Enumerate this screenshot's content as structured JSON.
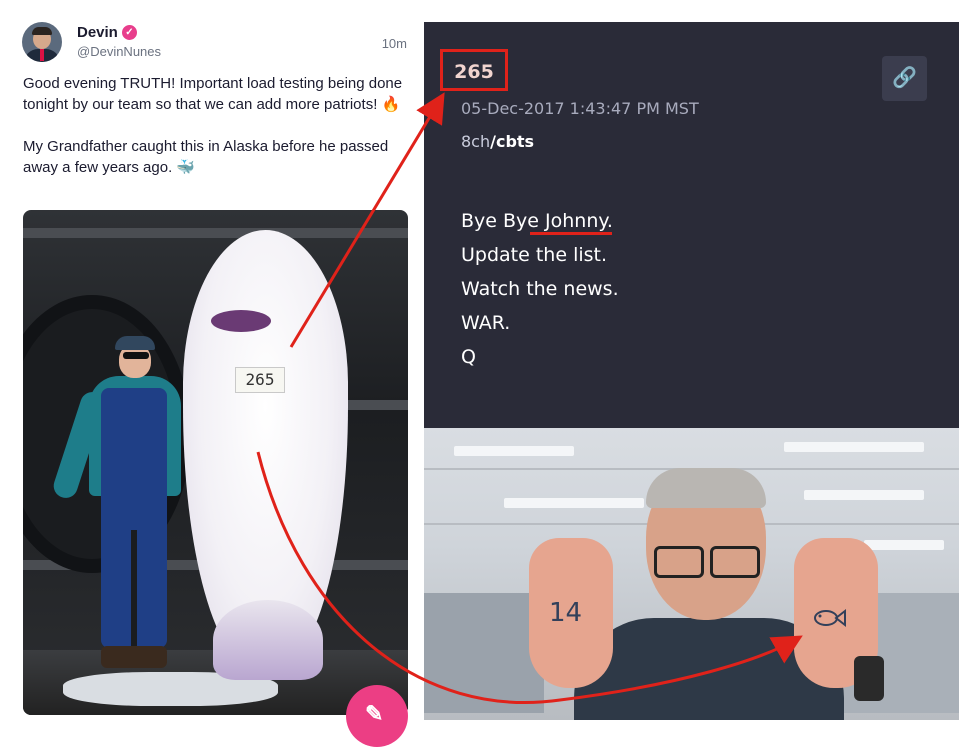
{
  "post": {
    "author_name": "Devin",
    "author_handle": "@DevinNunes",
    "time_ago": "10m",
    "text": "Good evening TRUTH! Important load testing being done tonight by our team so that we can add more patriots! 🔥\n\nMy Grandfather caught this in Alaska before he passed away a few years ago. 🐳",
    "fish_tag": "265",
    "verified_icon": "verified-badge-icon",
    "compose_icon": "compose-icon",
    "accent_color": "#ec3e84"
  },
  "qpost": {
    "post_number": "265",
    "timestamp": "05-Dec-2017 1:43:47 PM MST",
    "board_prefix": "8ch",
    "board_name": "/cbts",
    "lines": [
      "Bye Bye Johnny.",
      "Update the list.",
      "Watch the news.",
      "WAR.",
      "Q"
    ],
    "link_icon": "link-icon",
    "highlight_color": "#e0221a"
  },
  "photo2": {
    "left_hand_text": "14",
    "right_hand_text": "fish-drawing"
  }
}
